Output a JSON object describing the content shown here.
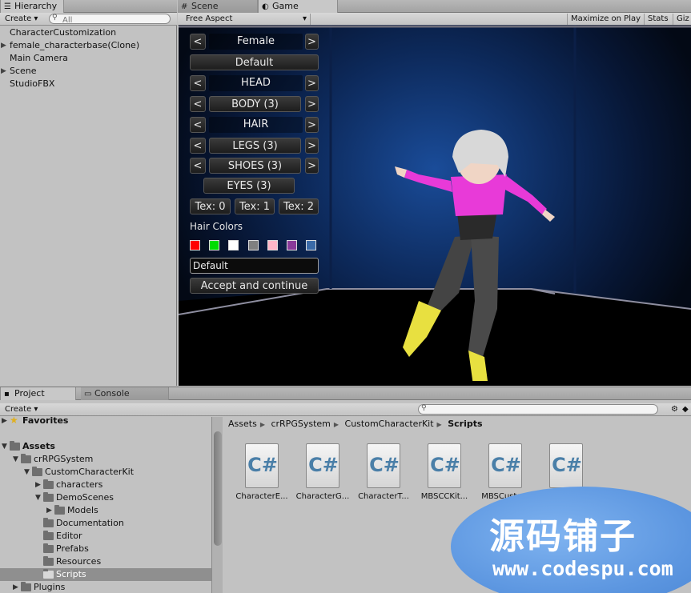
{
  "hierarchy": {
    "tab": "Hierarchy",
    "create_label": "Create",
    "search_placeholder": "All",
    "items": [
      {
        "label": "CharacterCustomization",
        "expandable": false
      },
      {
        "label": "female_characterbase(Clone)",
        "expandable": true
      },
      {
        "label": "Main Camera",
        "expandable": false
      },
      {
        "label": "Scene",
        "expandable": true
      },
      {
        "label": "StudioFBX",
        "expandable": false
      }
    ]
  },
  "tabs": {
    "scene": "Scene",
    "game": "Game"
  },
  "game_toolbar": {
    "aspect": "Free Aspect",
    "maximize": "Maximize on Play",
    "stats": "Stats",
    "gizmos": "Giz"
  },
  "customizer": {
    "prev": "<",
    "next": ">",
    "gender": "Female",
    "preset": "Default",
    "head": "HEAD",
    "body": "BODY (3)",
    "hair": "HAIR",
    "legs": "LEGS (3)",
    "shoes": "SHOES (3)",
    "eyes": "EYES (3)",
    "tex0": "Tex: 0",
    "tex1": "Tex: 1",
    "tex2": "Tex: 2",
    "hair_colors_label": "Hair Colors",
    "hair_colors": [
      "#ff0000",
      "#00dd00",
      "#ffffff",
      "#808080",
      "#ffb6c8",
      "#8a3a9a",
      "#3a6aa8"
    ],
    "name_value": "Default",
    "accept": "Accept and continue"
  },
  "project": {
    "tab": "Project",
    "console_tab": "Console",
    "create_label": "Create",
    "tree": [
      {
        "label": "Favorites",
        "bold": true,
        "level": 0,
        "icon": "star-icon"
      },
      {
        "label": "Assets",
        "bold": true,
        "level": 0,
        "icon": "folder-icon"
      },
      {
        "label": "crRPGSystem",
        "level": 1,
        "icon": "folder-icon"
      },
      {
        "label": "CustomCharacterKit",
        "level": 2,
        "icon": "folder-icon"
      },
      {
        "label": "characters",
        "level": 3,
        "icon": "folder-icon"
      },
      {
        "label": "DemoScenes",
        "level": 3,
        "icon": "folder-icon"
      },
      {
        "label": "Models",
        "level": 4,
        "icon": "folder-icon"
      },
      {
        "label": "Documentation",
        "level": 3,
        "icon": "folder-icon"
      },
      {
        "label": "Editor",
        "level": 3,
        "icon": "folder-icon"
      },
      {
        "label": "Prefabs",
        "level": 3,
        "icon": "folder-icon"
      },
      {
        "label": "Resources",
        "level": 3,
        "icon": "folder-icon"
      },
      {
        "label": "Scripts",
        "level": 3,
        "icon": "folder-icon",
        "selected": true
      },
      {
        "label": "Plugins",
        "level": 1,
        "icon": "folder-icon"
      }
    ],
    "breadcrumb": [
      "Assets",
      "crRPGSystem",
      "CustomCharacterKit",
      "Scripts"
    ],
    "assets": [
      "CharacterE...",
      "CharacterG...",
      "CharacterT...",
      "MBSCCKit...",
      "MBSCusto...",
      ""
    ],
    "asset_glyph": "C#"
  },
  "watermark": {
    "cn": "源码铺子",
    "url": "www.codespu.com"
  }
}
